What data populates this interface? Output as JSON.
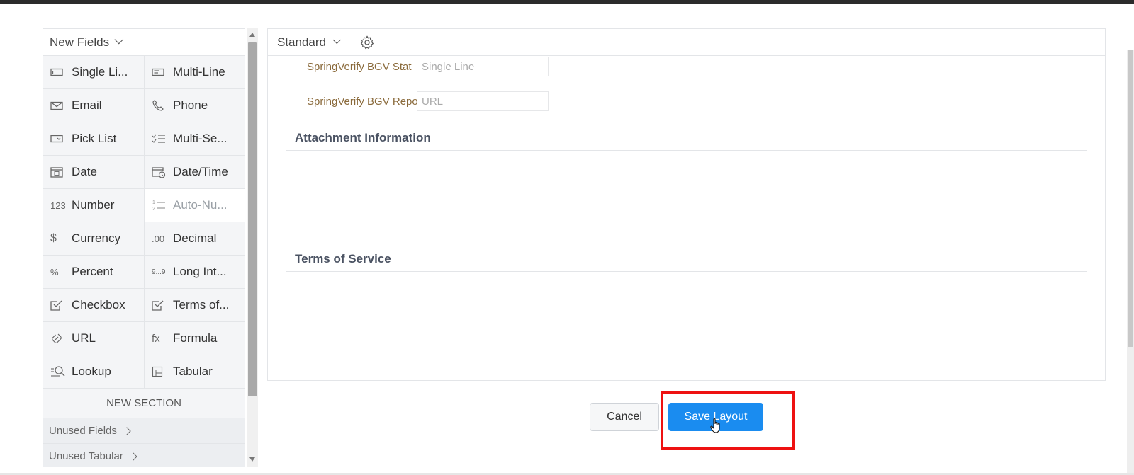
{
  "palette": {
    "header": "New Fields",
    "fields": [
      {
        "label": "Single Li...",
        "icon": "single-line-icon",
        "disabled": false
      },
      {
        "label": "Multi-Line",
        "icon": "multi-line-icon",
        "disabled": false
      },
      {
        "label": "Email",
        "icon": "email-icon",
        "disabled": false
      },
      {
        "label": "Phone",
        "icon": "phone-icon",
        "disabled": false
      },
      {
        "label": "Pick List",
        "icon": "pick-list-icon",
        "disabled": false
      },
      {
        "label": "Multi-Se...",
        "icon": "multi-select-icon",
        "disabled": false
      },
      {
        "label": "Date",
        "icon": "calendar-icon",
        "disabled": false
      },
      {
        "label": "Date/Time",
        "icon": "date-time-icon",
        "disabled": false
      },
      {
        "label": "Number",
        "icon": "number-icon",
        "disabled": false
      },
      {
        "label": "Auto-Nu...",
        "icon": "auto-number-icon",
        "disabled": true
      },
      {
        "label": "Currency",
        "icon": "currency-icon",
        "disabled": false
      },
      {
        "label": "Decimal",
        "icon": "decimal-icon",
        "disabled": false
      },
      {
        "label": "Percent",
        "icon": "percent-icon",
        "disabled": false
      },
      {
        "label": "Long Int...",
        "icon": "long-integer-icon",
        "disabled": false
      },
      {
        "label": "Checkbox",
        "icon": "checkbox-icon",
        "disabled": false
      },
      {
        "label": "Terms of...",
        "icon": "terms-icon",
        "disabled": false
      },
      {
        "label": "URL",
        "icon": "link-icon",
        "disabled": false
      },
      {
        "label": "Formula",
        "icon": "formula-icon",
        "disabled": false
      },
      {
        "label": "Lookup",
        "icon": "lookup-icon",
        "disabled": false
      },
      {
        "label": "Tabular",
        "icon": "table-icon",
        "disabled": false
      }
    ],
    "icon_glyphs": {
      "number": "123",
      "auto_number": "1⁄2",
      "currency": "$",
      "decimal": ".00",
      "percent": "%",
      "long_integer": "9...9",
      "formula": "fx"
    },
    "new_section": "NEW SECTION",
    "unused_fields": "Unused Fields",
    "unused_tabular": "Unused Tabular"
  },
  "canvas": {
    "layout_name": "Standard",
    "rows": [
      {
        "label": "SpringVerify BGV Stat",
        "placeholder": "Single Line"
      },
      {
        "label": "SpringVerify BGV Repo",
        "placeholder": "URL"
      }
    ],
    "sections": [
      "Attachment Information",
      "Terms of Service"
    ]
  },
  "actions": {
    "cancel": "Cancel",
    "save": "Save Layout"
  },
  "colors": {
    "accent": "#1a8cf0",
    "highlight": "#ee1111",
    "field_label": "#8a6a3b"
  }
}
